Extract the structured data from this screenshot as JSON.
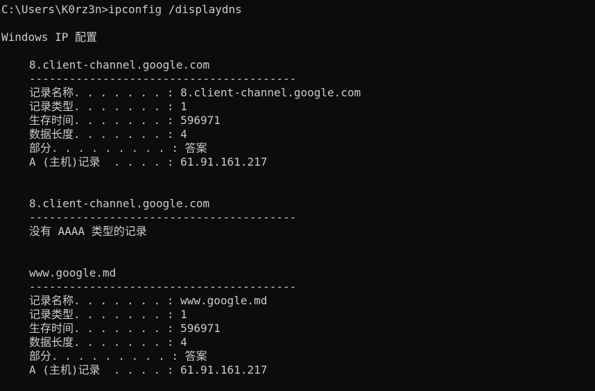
{
  "console": {
    "prompt": "C:\\Users\\K0rz3n>ipconfig /displaydns",
    "heading": "Windows IP 配置",
    "entries": [
      {
        "name": "8.client-channel.google.com",
        "separator": "----------------------------------------",
        "fields": [
          "记录名称. . . . . . . : 8.client-channel.google.com",
          "记录类型. . . . . . . : 1",
          "生存时间. . . . . . . : 596971",
          "数据长度. . . . . . . : 4",
          "部分. . . . . . . . . : 答案",
          "A (主机)记录  . . . . : 61.91.161.217"
        ]
      },
      {
        "name": "8.client-channel.google.com",
        "separator": "----------------------------------------",
        "message": "没有 AAAA 类型的记录"
      },
      {
        "name": "www.google.md",
        "separator": "----------------------------------------",
        "fields": [
          "记录名称. . . . . . . : www.google.md",
          "记录类型. . . . . . . : 1",
          "生存时间. . . . . . . : 596971",
          "数据长度. . . . . . . : 4",
          "部分. . . . . . . . . : 答案",
          "A (主机)记录  . . . . : 61.91.161.217"
        ]
      }
    ]
  }
}
